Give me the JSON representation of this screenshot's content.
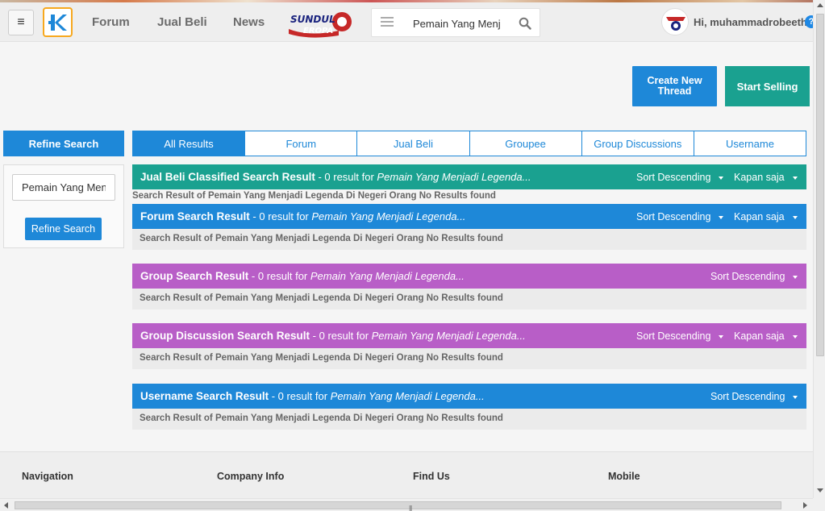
{
  "header": {
    "menu_icon": "hamburger-icon",
    "logo_icon": "kaskus-k-logo",
    "nav": [
      "Forum",
      "Jual Beli",
      "News"
    ],
    "promo_logo": [
      "SUNDUL",
      "EROPA"
    ],
    "search_value": "Pemain Yang Menjadi Legenda Di Negeri Orang",
    "greeting": "Hi, muhammadrobeeth",
    "help": "?"
  },
  "actions": {
    "create_thread": "Create New Thread",
    "start_selling": "Start Selling"
  },
  "sidebar": {
    "heading": "Refine Search",
    "input_value": "Pemain Yang Menjadi Legenda Di Negeri Orang",
    "button": "Refine Search"
  },
  "tabs": [
    "All Results",
    "Forum",
    "Jual Beli",
    "Groupee",
    "Group Discussions",
    "Username"
  ],
  "active_tab": "All Results",
  "results": {
    "jualbeli": {
      "title": "Jual Beli Classified Search Result",
      "count": " - 0 result for ",
      "query": "Pemain Yang Menjadi Legenda...",
      "sort": "Sort Descending",
      "time": "Kapan saja",
      "empty": "Search Result of Pemain Yang Menjadi Legenda Di Negeri Orang No Results found"
    },
    "forum": {
      "title": "Forum Search Result",
      "count": " - 0 result for ",
      "query": "Pemain Yang Menjadi Legenda...",
      "sort": "Sort Descending",
      "time": "Kapan saja",
      "empty": "Search Result of Pemain Yang Menjadi Legenda Di Negeri Orang No Results found"
    },
    "group": {
      "title": "Group Search Result",
      "count": " - 0 result for ",
      "query": "Pemain Yang Menjadi Legenda...",
      "sort": "Sort Descending",
      "empty": "Search Result of Pemain Yang Menjadi Legenda Di Negeri Orang No Results found"
    },
    "groupdisc": {
      "title": "Group Discussion Search Result",
      "count": " - 0 result for ",
      "query": "Pemain Yang Menjadi Legenda...",
      "sort": "Sort Descending",
      "time": "Kapan saja",
      "empty": "Search Result of Pemain Yang Menjadi Legenda Di Negeri Orang No Results found"
    },
    "username": {
      "title": "Username Search Result",
      "count": " - 0 result for ",
      "query": "Pemain Yang Menjadi Legenda...",
      "sort": "Sort Descending",
      "empty": "Search Result of Pemain Yang Menjadi Legenda Di Negeri Orang No Results found"
    }
  },
  "footer": {
    "headings": [
      "Navigation",
      "Company Info",
      "Find Us",
      "Mobile"
    ]
  },
  "colors": {
    "blue": "#1e88d8",
    "green": "#1aa190",
    "purple": "#b85ec7",
    "logo_border": "#f7a81e"
  }
}
